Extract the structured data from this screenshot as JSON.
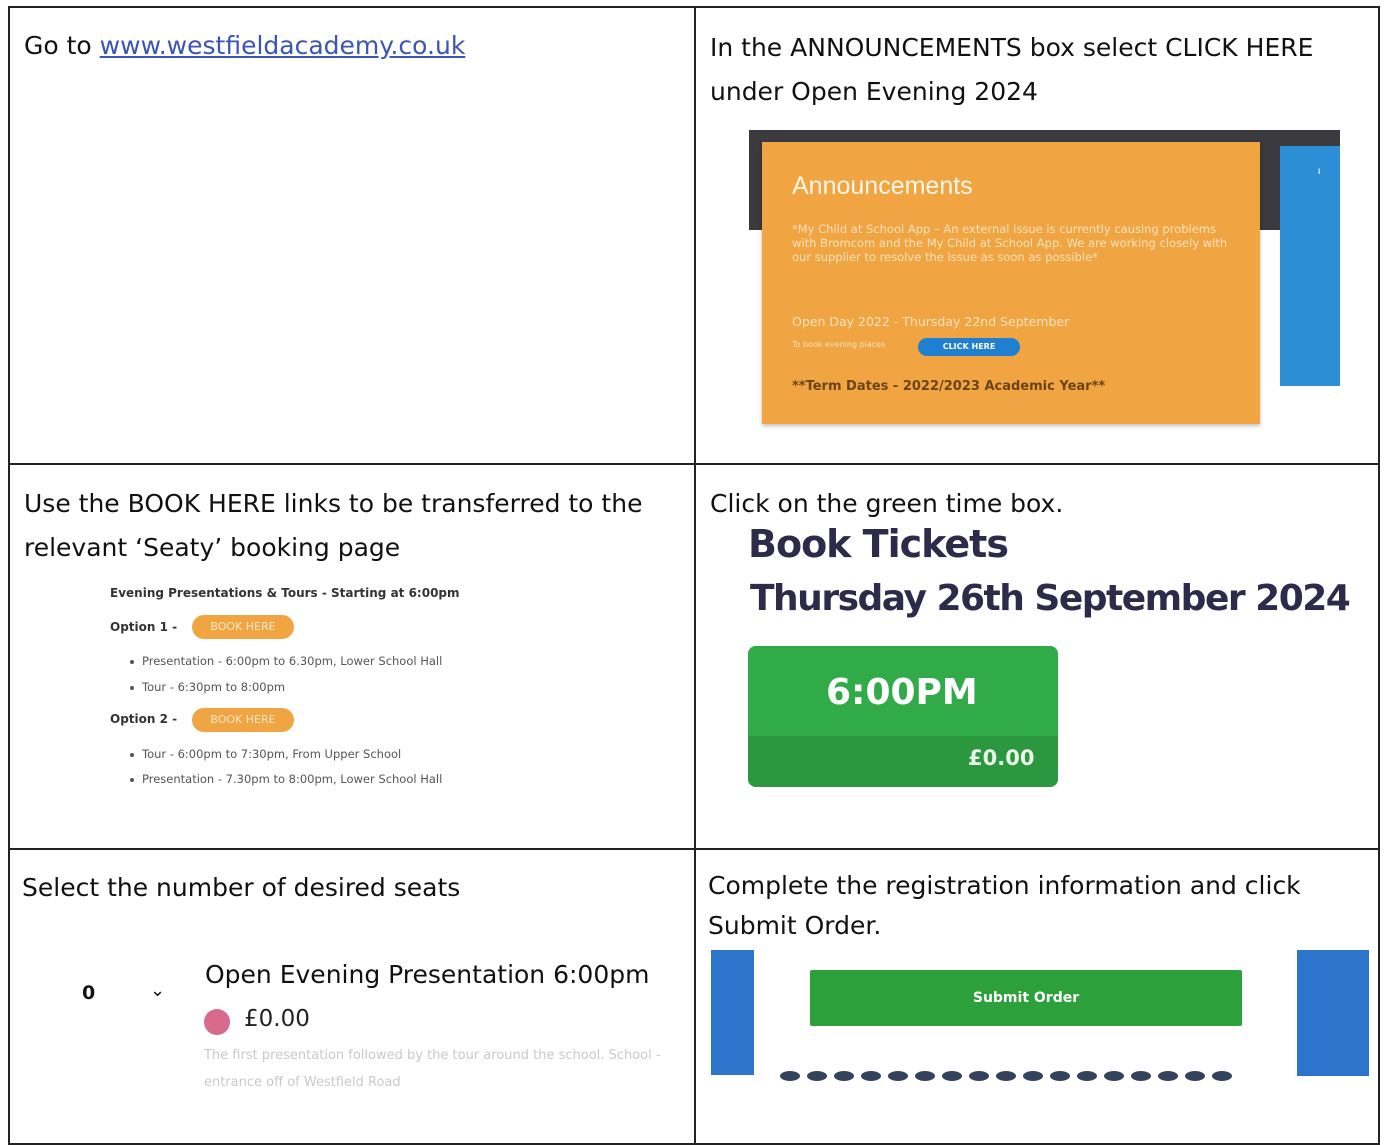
{
  "cells": {
    "step1": {
      "prefix": "Go to ",
      "link": "www.westfieldacademy.co.uk"
    },
    "step2": {
      "text": "In the ANNOUNCEMENTS box select CLICK HERE under Open Evening 2024",
      "announcement": {
        "title": "Announcements",
        "body": "*My Child at School App – An external issue is currently causing problems with Bromcom and the My Child at School App. We are working closely with our supplier to resolve the issue as soon as possible*",
        "open_day": "Open Day 2022 - Thursday 22nd September",
        "book_text": "To book evening places",
        "button": "CLICK HERE",
        "term_dates": "**Term Dates - 2022/2023 Academic Year**"
      }
    },
    "step3": {
      "text": "Use the BOOK HERE links to be transferred to the relevant ‘Seaty’ booking page",
      "heading": "Evening Presentations & Tours - Starting at 6:00pm",
      "options": [
        {
          "label": "Option 1 -",
          "button": "BOOK HERE",
          "items": [
            "Presentation - 6:00pm to 6.30pm, Lower School Hall",
            "Tour - 6:30pm to 8:00pm"
          ]
        },
        {
          "label": "Option 2 -",
          "button": "BOOK HERE",
          "items": [
            "Tour - 6:00pm to 7:30pm, From Upper School",
            "Presentation - 7.30pm to 8:00pm, Lower School Hall"
          ]
        }
      ]
    },
    "step4": {
      "text": "Click on the green time box.",
      "title": "Book Tickets",
      "date": "Thursday 26th September 2024",
      "time": "6:00PM",
      "price": "£0.00"
    },
    "step5": {
      "text": "Select the number of desired seats",
      "quantity": "0",
      "event": "Open Evening Presentation 6:00pm",
      "price": "£0.00",
      "desc": "The first presentation followed by the tour around the school. School - entrance off of Westfield Road"
    },
    "step6": {
      "text": "Complete the registration information and click Submit Order.",
      "button": "Submit Order"
    }
  },
  "colors": {
    "orange": "#f0a442",
    "green": "#2ea043",
    "blue": "#2d74cc"
  }
}
